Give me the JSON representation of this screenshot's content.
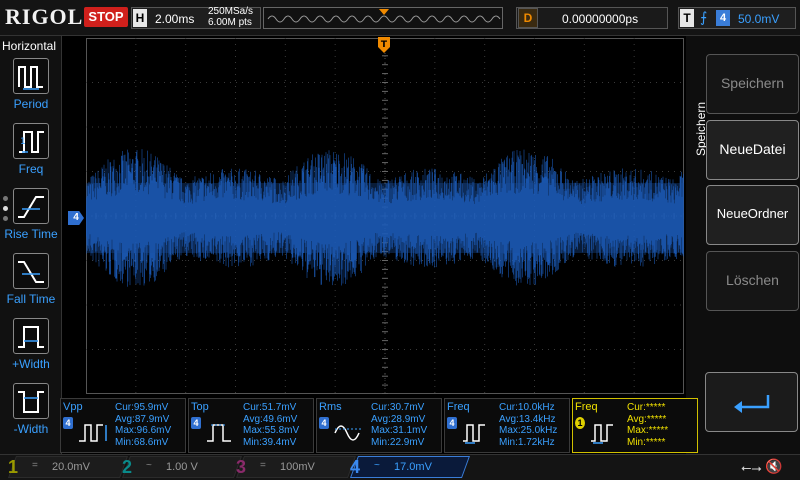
{
  "topbar": {
    "logo": "RIGOL",
    "run_state": "STOP",
    "horizontal_badge": "H",
    "timebase": "2.00ms",
    "sample_rate": "250MSa/s",
    "memory_depth": "6.00M pts",
    "trigger_marker": "T",
    "delay_badge": "D",
    "delay": "0.00000000ps",
    "trigger_badge": "T",
    "trigger_source": "4",
    "trigger_level": "50.0mV"
  },
  "left_menu": {
    "title": "Horizontal",
    "items": [
      {
        "label": "Period",
        "icon": "period-icon"
      },
      {
        "label": "Freq",
        "icon": "frequency-icon"
      },
      {
        "label": "Rise Time",
        "icon": "rise-time-icon"
      },
      {
        "label": "Fall Time",
        "icon": "fall-time-icon"
      },
      {
        "label": "+Width",
        "icon": "positive-width-icon"
      },
      {
        "label": "-Width",
        "icon": "negative-width-icon"
      }
    ]
  },
  "screen": {
    "channel_marker": "4",
    "trigger_position": "T",
    "waveform_color": "#1e63c8"
  },
  "right_menu": {
    "title": "Speichern",
    "buttons": [
      {
        "label": "Speichern",
        "enabled": false
      },
      {
        "label": "NeueDatei",
        "enabled": true
      },
      {
        "label": "NeueOrdner",
        "enabled": true
      },
      {
        "label": "Löschen",
        "enabled": false
      }
    ],
    "back_icon": "return-arrow-icon"
  },
  "measurements": [
    {
      "name": "Vpp",
      "channel": "4",
      "cur": "Cur:95.9mV",
      "avg": "Avg:87.9mV",
      "max": "Max:96.6mV",
      "min": "Min:68.6mV",
      "icon": "vpp-icon"
    },
    {
      "name": "Top",
      "channel": "4",
      "cur": "Cur:51.7mV",
      "avg": "Avg:49.6mV",
      "max": "Max:55.8mV",
      "min": "Min:39.4mV",
      "icon": "top-icon"
    },
    {
      "name": "Rms",
      "channel": "4",
      "cur": "Cur:30.7mV",
      "avg": "Avg:28.9mV",
      "max": "Max:31.1mV",
      "min": "Min:22.9mV",
      "icon": "rms-icon"
    },
    {
      "name": "Freq",
      "channel": "4",
      "cur": "Cur:10.0kHz",
      "avg": "Avg:13.4kHz",
      "max": "Max:25.0kHz",
      "min": "Min:1.72kHz",
      "icon": "freq-icon"
    },
    {
      "name": "Freq",
      "channel": "1",
      "cur": "Cur:*****",
      "avg": "Avg:*****",
      "max": "Max:*****",
      "min": "Min:*****",
      "icon": "freq-icon"
    }
  ],
  "channels": [
    {
      "num": "1",
      "coupling": "=",
      "scale": "20.0mV",
      "color": "#9a9a00",
      "active": false
    },
    {
      "num": "2",
      "coupling": "~",
      "scale": "1.00 V",
      "color": "#0a8a8a",
      "active": false
    },
    {
      "num": "3",
      "coupling": "=",
      "scale": "100mV",
      "color": "#8a2a6a",
      "active": false
    },
    {
      "num": "4",
      "coupling": "~",
      "scale": "17.0mV",
      "color": "#3a8af0",
      "active": true
    }
  ],
  "status": {
    "usb_icon": "usb-icon",
    "mute_icon": "speaker-mute-icon"
  }
}
